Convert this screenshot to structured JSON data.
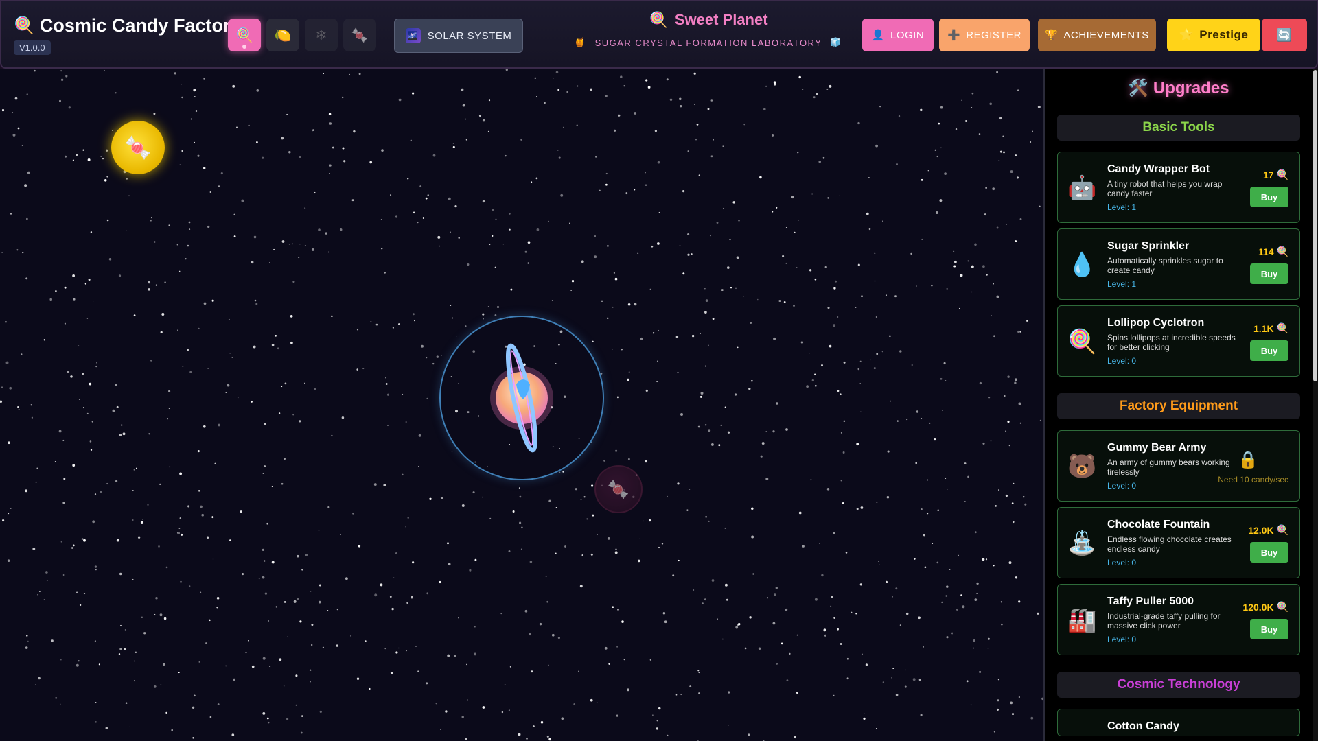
{
  "header": {
    "title": "Cosmic Candy Factory",
    "version": "V1.0.0",
    "solar_label": "SOLAR SYSTEM",
    "planet_name": "Sweet Planet",
    "planet_subtitle": "SUGAR CRYSTAL FORMATION LABORATORY",
    "login": "LOGIN",
    "register": "REGISTER",
    "achievements": "ACHIEVEMENTS",
    "prestige": "Prestige",
    "planet_buttons": [
      {
        "icon": "lollipop-icon",
        "glyph": "🍭",
        "active": true
      },
      {
        "icon": "lemon-icon",
        "glyph": "🍋",
        "active": false
      },
      {
        "icon": "snowflake-icon",
        "glyph": "❄",
        "active": false
      },
      {
        "icon": "candy-cane-icon",
        "glyph": "🍬",
        "active": false
      }
    ]
  },
  "upgrades": {
    "title": "🛠️ Upgrades",
    "categories": [
      {
        "name": "Basic Tools",
        "color": "#8bd44a"
      },
      {
        "name": "Factory Equipment",
        "color": "#ff9b1a"
      },
      {
        "name": "Cosmic Technology",
        "color": "#c93fd6"
      }
    ],
    "items": [
      {
        "name": "Candy Wrapper Bot",
        "desc": "A tiny robot that helps you wrap candy faster",
        "level": "Level: 1",
        "cost": "17",
        "buy": "Buy",
        "icon": "🤖"
      },
      {
        "name": "Sugar Sprinkler",
        "desc": "Automatically sprinkles sugar to create candy",
        "level": "Level: 1",
        "cost": "114",
        "buy": "Buy",
        "icon": "💧"
      },
      {
        "name": "Lollipop Cyclotron",
        "desc": "Spins lollipops at incredible speeds for better clicking",
        "level": "Level: 0",
        "cost": "1.1K",
        "buy": "Buy",
        "icon": "🍭"
      },
      {
        "name": "Gummy Bear Army",
        "desc": "An army of gummy bears working tirelessly",
        "level": "Level: 0",
        "need": "Need 10 candy/sec",
        "icon": "🐻"
      },
      {
        "name": "Chocolate Fountain",
        "desc": "Endless flowing chocolate creates endless candy",
        "level": "Level: 0",
        "cost": "12.0K",
        "buy": "Buy",
        "icon": "⛲"
      },
      {
        "name": "Taffy Puller 5000",
        "desc": "Industrial-grade taffy pulling for massive click power",
        "level": "Level: 0",
        "cost": "120.0K",
        "buy": "Buy",
        "icon": "🏭"
      },
      {
        "name": "Cotton Candy"
      }
    ]
  }
}
